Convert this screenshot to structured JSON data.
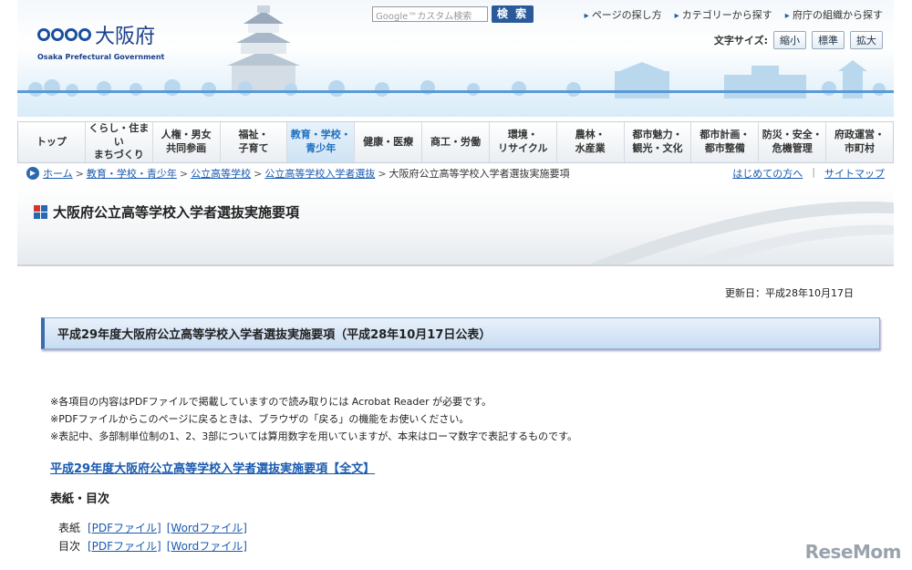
{
  "header": {
    "logo_text": "大阪府",
    "logo_sub": "Osaka Prefectural Government",
    "search_placeholder": "Google™カスタム検索",
    "search_button": "検 索",
    "top_links": [
      "ページの探し方",
      "カテゴリーから探す",
      "府庁の組織から探す"
    ],
    "font_size_label": "文字サイズ:",
    "font_size_buttons": [
      "縮小",
      "標準",
      "拡大"
    ]
  },
  "nav": {
    "items": [
      "トップ",
      "くらし・住まい\nまちづくり",
      "人権・男女\n共同参画",
      "福祉・\n子育て",
      "教育・学校・\n青少年",
      "健康・医療",
      "商工・労働",
      "環境・\nリサイクル",
      "農林・\n水産業",
      "都市魅力・\n観光・文化",
      "都市計画・\n都市整備",
      "防災・安全・\n危機管理",
      "府政運営・\n市町村"
    ],
    "active_index": 4
  },
  "breadcrumb": {
    "links": [
      "ホーム",
      "教育・学校・青少年",
      "公立高等学校",
      "公立高等学校入学者選抜"
    ],
    "current": "大阪府公立高等学校入学者選抜実施要項",
    "right_links": [
      "はじめての方へ",
      "サイトマップ"
    ]
  },
  "page": {
    "title": "大阪府公立高等学校入学者選抜実施要項",
    "updated": "更新日：平成28年10月17日",
    "section_heading": "平成29年度大阪府公立高等学校入学者選抜実施要項（平成28年10月17日公表）",
    "notes": [
      "※各項目の内容はPDFファイルで掲載していますので読み取りには Acrobat Reader が必要です。",
      "※PDFファイルからこのページに戻るときは、ブラウザの「戻る」の機能をお使いください。",
      "※表記中、多部制単位制の1、2、3部については算用数字を用いていますが、本来はローマ数字で表記するものです。"
    ],
    "main_link": "平成29年度大阪府公立高等学校入学者選抜実施要項【全文】",
    "sub_heading": "表紙・目次",
    "files": [
      {
        "label": "表紙",
        "pdf": "[PDFファイル]",
        "word": "[Wordファイル]"
      },
      {
        "label": "目次",
        "pdf": "[PDFファイル]",
        "word": "[Wordファイル]"
      }
    ]
  },
  "watermark": "ReseMom",
  "colors": {
    "accent": "#1a5ab0",
    "nav_active": "#1d6fc1",
    "heading_border": "#3a6db0"
  }
}
